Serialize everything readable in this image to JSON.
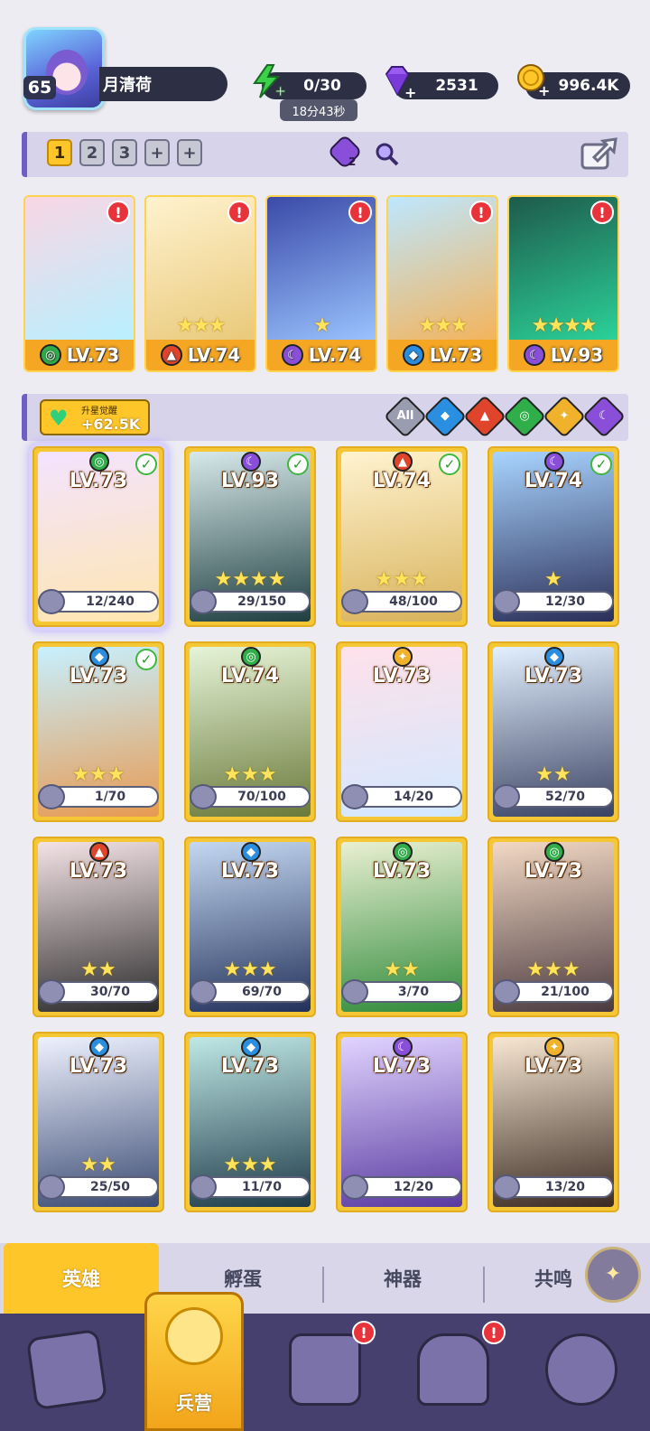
{
  "player": {
    "level": "65",
    "name": "月清荷"
  },
  "resources": {
    "energy": "0/30",
    "energy_timer": "18分43秒",
    "gems": "2531",
    "gold": "996.4K"
  },
  "team_bar": {
    "slots": [
      "1",
      "2",
      "3",
      "+",
      "+"
    ],
    "active_slot": "1",
    "badge_count": "2"
  },
  "team": [
    {
      "level": "LV.73",
      "element": "wind",
      "stars": 0,
      "alert": true,
      "art": [
        "#f9d6e4",
        "#b8f0ff"
      ]
    },
    {
      "level": "LV.74",
      "element": "fire",
      "stars": 3,
      "alert": true,
      "art": [
        "#fff2cf",
        "#e9c979"
      ]
    },
    {
      "level": "LV.74",
      "element": "dark",
      "stars": 1,
      "alert": true,
      "art": [
        "#3a4aa8",
        "#9bc4ff"
      ]
    },
    {
      "level": "LV.73",
      "element": "water",
      "stars": 3,
      "alert": true,
      "art": [
        "#bde7ff",
        "#f4b35a"
      ]
    },
    {
      "level": "LV.93",
      "element": "dark",
      "stars": 4,
      "alert": true,
      "art": [
        "#1e5a4a",
        "#2bd39a"
      ]
    }
  ],
  "awaken": {
    "label": "升星觉醒",
    "value": "+62.5K"
  },
  "filters": [
    "All",
    "water",
    "fire",
    "wind",
    "light",
    "dark"
  ],
  "heroes": [
    {
      "level": "LV.73",
      "element": "wind",
      "progress": "12/240",
      "stars": 0,
      "check": true,
      "selected": true,
      "art": [
        "#f3e3ff",
        "#ffe6b0"
      ]
    },
    {
      "level": "LV.93",
      "element": "dark",
      "progress": "29/150",
      "stars": 4,
      "check": true,
      "art": [
        "#d7e9ea",
        "#1e3e40"
      ]
    },
    {
      "level": "LV.74",
      "element": "fire",
      "progress": "48/100",
      "stars": 3,
      "check": true,
      "art": [
        "#fff3d0",
        "#d8b25a"
      ]
    },
    {
      "level": "LV.74",
      "element": "dark",
      "progress": "12/30",
      "stars": 1,
      "check": true,
      "art": [
        "#a8d4ff",
        "#2a2f58"
      ]
    },
    {
      "level": "LV.73",
      "element": "water",
      "progress": "1/70",
      "stars": 3,
      "check": true,
      "art": [
        "#c7f0ff",
        "#e79a52"
      ]
    },
    {
      "level": "LV.74",
      "element": "wind",
      "progress": "70/100",
      "stars": 3,
      "check": false,
      "art": [
        "#e6f4d8",
        "#6a7a3a"
      ]
    },
    {
      "level": "LV.73",
      "element": "light",
      "progress": "14/20",
      "stars": 0,
      "check": false,
      "art": [
        "#ffe1ea",
        "#d2e8ff"
      ]
    },
    {
      "level": "LV.73",
      "element": "water",
      "progress": "52/70",
      "stars": 2,
      "check": false,
      "art": [
        "#e2f0ff",
        "#3a4262"
      ]
    },
    {
      "level": "LV.73",
      "element": "fire",
      "progress": "30/70",
      "stars": 2,
      "check": false,
      "art": [
        "#f4e3e6",
        "#2a2a2a"
      ]
    },
    {
      "level": "LV.73",
      "element": "water",
      "progress": "69/70",
      "stars": 3,
      "check": false,
      "art": [
        "#c4d8f2",
        "#22315a"
      ]
    },
    {
      "level": "LV.73",
      "element": "wind",
      "progress": "3/70",
      "stars": 2,
      "check": false,
      "art": [
        "#e9f0d2",
        "#2f8a3a"
      ]
    },
    {
      "level": "LV.73",
      "element": "wind",
      "progress": "21/100",
      "stars": 3,
      "check": false,
      "art": [
        "#f3d9c4",
        "#4a3a40"
      ]
    },
    {
      "level": "LV.73",
      "element": "water",
      "progress": "25/50",
      "stars": 2,
      "check": false,
      "art": [
        "#eef2ff",
        "#3a4a72"
      ]
    },
    {
      "level": "LV.73",
      "element": "water",
      "progress": "11/70",
      "stars": 3,
      "check": false,
      "art": [
        "#bfe8e6",
        "#1e3a48"
      ]
    },
    {
      "level": "LV.73",
      "element": "dark",
      "progress": "12/20",
      "stars": 0,
      "check": false,
      "art": [
        "#e0d4ff",
        "#5a3aa0"
      ]
    },
    {
      "level": "LV.73",
      "element": "light",
      "progress": "13/20",
      "stars": 0,
      "check": false,
      "art": [
        "#f7e7d2",
        "#3a2a22"
      ]
    }
  ],
  "tabs": [
    {
      "label": "英雄",
      "active": true
    },
    {
      "label": "孵蛋"
    },
    {
      "label": "神器"
    },
    {
      "label": "共鸣"
    }
  ],
  "nav": [
    {
      "icon": "cards-icon"
    },
    {
      "label": "兵营",
      "icon": "barracks-icon",
      "active": true
    },
    {
      "icon": "map-icon",
      "alert": true
    },
    {
      "icon": "castle-icon",
      "alert": true
    },
    {
      "icon": "mushroom-icon"
    }
  ],
  "colors": {
    "accent": "#ffc62a",
    "fire": "#e0452b",
    "water": "#2a8fe0",
    "wind": "#2fae4a",
    "light": "#f0b22a",
    "dark": "#8a4fd8",
    "alert": "#e8333a"
  }
}
